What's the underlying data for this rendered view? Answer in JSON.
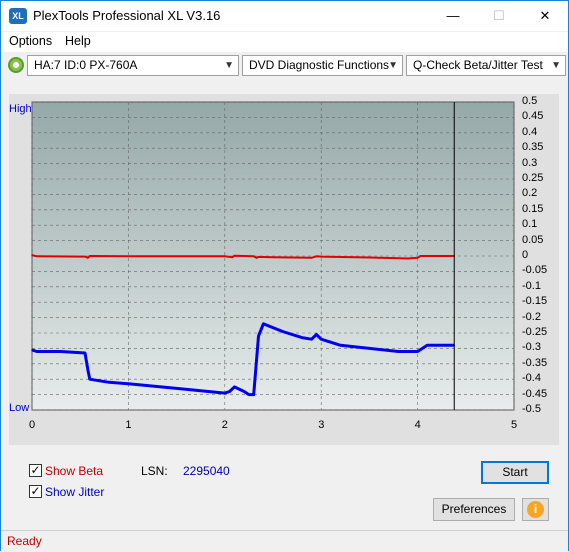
{
  "window": {
    "title": "PlexTools Professional XL V3.16",
    "icon_label": "XL",
    "minimize_glyph": "—",
    "maximize_glyph": "☐",
    "close_glyph": "✕"
  },
  "menu": {
    "items": [
      {
        "label": "Options"
      },
      {
        "label": "Help"
      }
    ]
  },
  "toolbar": {
    "drive": "HA:7 ID:0  PX-760A",
    "function": "DVD Diagnostic Functions",
    "test": "Q-Check Beta/Jitter Test",
    "arrow_glyph": "▼"
  },
  "graph": {
    "y_left_top": "High",
    "y_left_bottom": "Low",
    "background_top": "#95a8a8",
    "background_bottom": "#e8ecec",
    "beta_color": "#e00000",
    "jitter_color": "#0000ee"
  },
  "chart_data": {
    "type": "line",
    "xlim": [
      0,
      5
    ],
    "ylim": [
      -0.5,
      0.5
    ],
    "x_ticks": [
      "0",
      "1",
      "2",
      "3",
      "4",
      "5"
    ],
    "y_ticks": [
      "0.5",
      "0.45",
      "0.4",
      "0.35",
      "0.3",
      "0.25",
      "0.2",
      "0.15",
      "0.1",
      "0.05",
      "0",
      "-0.05",
      "-0.1",
      "-0.15",
      "-0.2",
      "-0.25",
      "-0.3",
      "-0.35",
      "-0.4",
      "-0.45",
      "-0.5"
    ],
    "marker_x": 4.38,
    "series": [
      {
        "key": "beta",
        "x": [
          0,
          0.05,
          0.55,
          0.58,
          0.6,
          1.0,
          1.5,
          2.0,
          2.08,
          2.1,
          2.3,
          2.33,
          2.35,
          2.5,
          2.9,
          2.95,
          3.0,
          3.5,
          3.9,
          4.0,
          4.03,
          4.05,
          4.38
        ],
        "y": [
          0.003,
          -0.001,
          -0.002,
          -0.006,
          0.0,
          -0.001,
          -0.001,
          -0.001,
          -0.004,
          0.001,
          -0.001,
          -0.006,
          -0.003,
          -0.004,
          -0.006,
          -0.001,
          -0.002,
          -0.005,
          -0.008,
          -0.006,
          0.0,
          0.0,
          0.0
        ]
      },
      {
        "key": "jitter",
        "x": [
          0,
          0.05,
          0.3,
          0.55,
          0.58,
          0.6,
          0.8,
          1.0,
          1.5,
          2.0,
          2.05,
          2.1,
          2.2,
          2.25,
          2.3,
          2.35,
          2.4,
          2.6,
          2.8,
          2.9,
          2.95,
          3.0,
          3.2,
          3.5,
          3.8,
          4.0,
          4.05,
          4.1,
          4.38
        ],
        "y": [
          -0.305,
          -0.31,
          -0.31,
          -0.315,
          -0.37,
          -0.4,
          -0.41,
          -0.415,
          -0.43,
          -0.445,
          -0.44,
          -0.425,
          -0.44,
          -0.45,
          -0.45,
          -0.26,
          -0.22,
          -0.245,
          -0.265,
          -0.27,
          -0.255,
          -0.27,
          -0.29,
          -0.3,
          -0.31,
          -0.31,
          -0.3,
          -0.29,
          -0.29
        ]
      }
    ]
  },
  "options": {
    "show_beta_label": "Show Beta",
    "show_jitter_label": "Show Jitter",
    "show_beta_checked": true,
    "show_jitter_checked": true,
    "check_glyph": "✓",
    "lsn_label": "LSN:",
    "lsn_value": "2295040"
  },
  "buttons": {
    "start": "Start",
    "preferences": "Preferences",
    "info_glyph": "i"
  },
  "status": {
    "text": "Ready"
  }
}
